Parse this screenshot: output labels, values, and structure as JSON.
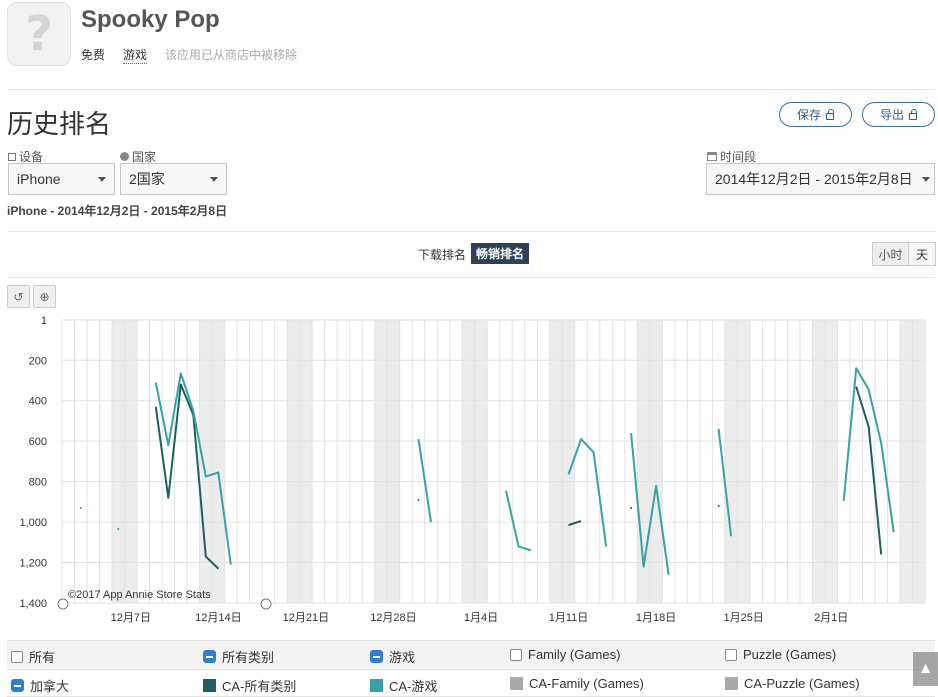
{
  "app": {
    "icon_glyph": "?",
    "title": "Spooky Pop",
    "price": "免费",
    "category": "游戏",
    "status": "该应用已从商店中被移除"
  },
  "page": {
    "title": "历史排名",
    "save_label": "保存",
    "export_label": "导出"
  },
  "filters": {
    "device_label": "设备",
    "device_value": "iPhone",
    "country_label": "国家",
    "country_value": "2国家",
    "period_label": "时间段",
    "period_value": "2014年12月2日 - 2015年2月8日",
    "summary": "iPhone - 2014年12月2日 - 2015年2月8日"
  },
  "rank_tabs": {
    "downloads": "下载排名",
    "grossing": "畅销排名"
  },
  "granularity": {
    "hour": "小时",
    "day": "天"
  },
  "toolbar": {
    "reset_icon": "↺",
    "zoom_icon": "⊕"
  },
  "colors": {
    "dark_teal": "#1f5f5f",
    "teal": "#35a3a6",
    "gray": "#aaaaaa",
    "weekend_band": "#ececec"
  },
  "chart_data": {
    "type": "line",
    "y_inverted": true,
    "ylim": [
      1,
      1400
    ],
    "y_ticks": [
      "1",
      "200",
      "400",
      "600",
      "800",
      "1,000",
      "1,200",
      "1,400"
    ],
    "y_tick_values": [
      1,
      200,
      400,
      600,
      800,
      1000,
      1200,
      1400
    ],
    "x_range": [
      "2014-12-02",
      "2015-02-08"
    ],
    "x_ticks": [
      {
        "label": "12月7日",
        "date": "2014-12-07"
      },
      {
        "label": "12月14日",
        "date": "2014-12-14"
      },
      {
        "label": "12月21日",
        "date": "2014-12-21"
      },
      {
        "label": "12月28日",
        "date": "2014-12-28"
      },
      {
        "label": "1月4日",
        "date": "2015-01-04"
      },
      {
        "label": "1月11日",
        "date": "2015-01-11"
      },
      {
        "label": "1月18日",
        "date": "2015-01-18"
      },
      {
        "label": "1月25日",
        "date": "2015-01-25"
      },
      {
        "label": "2月1日",
        "date": "2015-02-01"
      }
    ],
    "weekend_bands": [
      [
        "2014-12-06",
        "2014-12-08"
      ],
      [
        "2014-12-13",
        "2014-12-15"
      ],
      [
        "2014-12-20",
        "2014-12-22"
      ],
      [
        "2014-12-27",
        "2014-12-29"
      ],
      [
        "2015-01-03",
        "2015-01-05"
      ],
      [
        "2015-01-10",
        "2015-01-12"
      ],
      [
        "2015-01-17",
        "2015-01-19"
      ],
      [
        "2015-01-24",
        "2015-01-26"
      ],
      [
        "2015-01-31",
        "2015-02-02"
      ],
      [
        "2015-02-07",
        "2015-02-09"
      ]
    ],
    "grid": true,
    "watermark": "©2017 App Annie Store Stats",
    "series": [
      {
        "name": "CA-所有类别",
        "color": "#1f5f5f",
        "segments": [
          [
            [
              "2014-12-09",
              430
            ],
            [
              "2014-12-10",
              880
            ],
            [
              "2014-12-11",
              320
            ],
            [
              "2014-12-12",
              470
            ],
            [
              "2014-12-13",
              1170
            ],
            [
              "2014-12-14",
              1230
            ]
          ],
          [
            [
              "2014-12-30",
              890
            ]
          ],
          [
            [
              "2015-01-11",
              1015
            ],
            [
              "2015-01-12",
              995
            ]
          ],
          [
            [
              "2015-01-16",
              930
            ]
          ],
          [
            [
              "2015-01-23",
              920
            ]
          ],
          [
            [
              "2015-02-03",
              330
            ],
            [
              "2015-02-04",
              530
            ],
            [
              "2015-02-05",
              1160
            ]
          ]
        ]
      },
      {
        "name": "CA-游戏",
        "color": "#35a3a6",
        "segments": [
          [
            [
              "2014-12-03",
              930
            ]
          ],
          [
            [
              "2014-12-06",
              1035
            ]
          ],
          [
            [
              "2014-12-09",
              310
            ],
            [
              "2014-12-10",
              620
            ],
            [
              "2014-12-11",
              265
            ],
            [
              "2014-12-12",
              450
            ],
            [
              "2014-12-13",
              775
            ],
            [
              "2014-12-14",
              755
            ],
            [
              "2014-12-15",
              1210
            ]
          ],
          [
            [
              "2014-12-30",
              590
            ],
            [
              "2014-12-31",
              1000
            ]
          ],
          [
            [
              "2015-01-06",
              845
            ],
            [
              "2015-01-07",
              1120
            ],
            [
              "2015-01-08",
              1140
            ]
          ],
          [
            [
              "2015-01-11",
              765
            ],
            [
              "2015-01-12",
              590
            ],
            [
              "2015-01-13",
              655
            ],
            [
              "2015-01-14",
              1120
            ]
          ],
          [
            [
              "2015-01-16",
              560
            ],
            [
              "2015-01-17",
              1220
            ],
            [
              "2015-01-18",
              820
            ],
            [
              "2015-01-19",
              1260
            ]
          ],
          [
            [
              "2015-01-23",
              540
            ],
            [
              "2015-01-24",
              1070
            ]
          ],
          [
            [
              "2015-02-02",
              895
            ],
            [
              "2015-02-03",
              240
            ],
            [
              "2015-02-04",
              345
            ],
            [
              "2015-02-05",
              610
            ],
            [
              "2015-02-06",
              1050
            ]
          ]
        ]
      }
    ]
  },
  "legend": {
    "row1": [
      {
        "label": "所有",
        "state": "unchecked"
      },
      {
        "label": "所有类别",
        "state": "minus"
      },
      {
        "label": "游戏",
        "state": "minus"
      },
      {
        "label": "Family (Games)",
        "state": "unchecked"
      },
      {
        "label": "Puzzle (Games)",
        "state": "unchecked"
      }
    ],
    "row2": [
      {
        "label": "加拿大",
        "state": "minus"
      },
      {
        "label": "CA-所有类别",
        "color": "#1f5f5f"
      },
      {
        "label": "CA-游戏",
        "color": "#35a3a6"
      },
      {
        "label": "CA-Family (Games)",
        "color": "#aaaaaa"
      },
      {
        "label": "CA-Puzzle (Games)",
        "color": "#aaaaaa"
      }
    ]
  }
}
